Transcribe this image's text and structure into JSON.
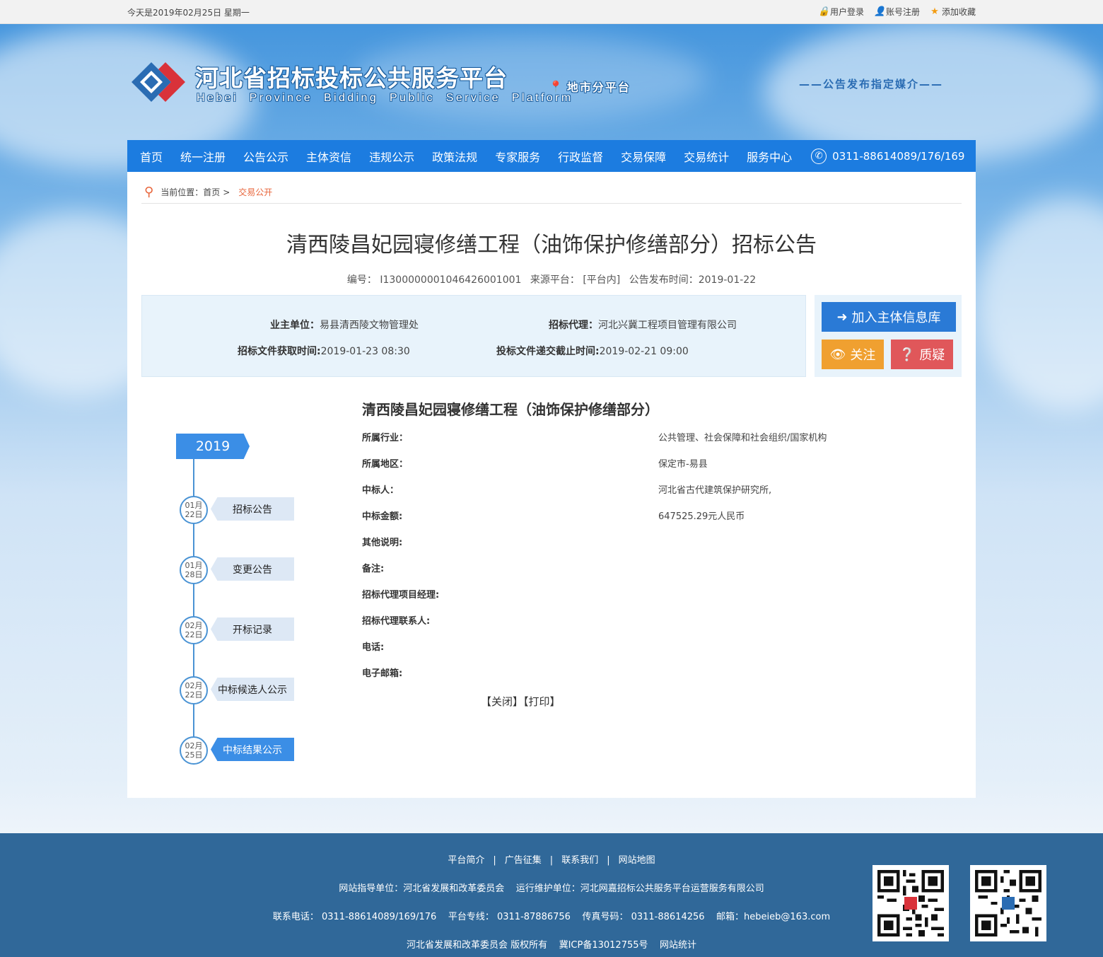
{
  "topbar": {
    "date": "今天是2019年02月25日 星期一",
    "login": "用户登录",
    "register": "账号注册",
    "favorite": "添加收藏"
  },
  "header": {
    "title": "河北省招标投标公共服务平台",
    "subtitle": "Hebei Province Bidding Public Service Platform",
    "city_platform": "地市分平台",
    "media": "——公告发布指定媒介——"
  },
  "nav": {
    "items": [
      "首页",
      "统一注册",
      "公告公示",
      "主体资信",
      "违规公示",
      "政策法规",
      "专家服务",
      "行政监督",
      "交易保障",
      "交易统计",
      "服务中心"
    ],
    "phone": "0311-88614089/176/169"
  },
  "breadcrumb": {
    "prefix": "当前位置：首页",
    "arrow": ">",
    "current": "交易公开"
  },
  "notice": {
    "title": "清西陵昌妃园寝修缮工程（油饰保护修缮部分）招标公告",
    "code_label": "编号：",
    "code": "I1300000001046426001001",
    "source_label": "来源平台：",
    "source": "[平台内]",
    "publish_label": "公告发布时间：",
    "publish": "2019-01-22"
  },
  "info": {
    "owner_label": "业主单位：",
    "owner": "易县清西陵文物管理处",
    "agent_label": "招标代理：",
    "agent": "河北兴冀工程项目管理有限公司",
    "doc_time_label": "招标文件获取时间:",
    "doc_time": "2019-01-23 08:30",
    "deadline_label": "投标文件递交截止时间:",
    "deadline": "2019-02-21 09:00"
  },
  "actions": {
    "join": "加入主体信息库",
    "follow": "关注",
    "query": "质疑"
  },
  "timeline": {
    "year": "2019",
    "items": [
      {
        "month": "01月",
        "day": "22日",
        "label": "招标公告"
      },
      {
        "month": "01月",
        "day": "28日",
        "label": "变更公告"
      },
      {
        "month": "02月",
        "day": "22日",
        "label": "开标记录"
      },
      {
        "month": "02月",
        "day": "22日",
        "label": "中标候选人公示"
      },
      {
        "month": "02月",
        "day": "25日",
        "label": "中标结果公示"
      }
    ]
  },
  "detail": {
    "heading": "清西陵昌妃园寝修缮工程（油饰保护修缮部分）",
    "rows": [
      {
        "key": "所属行业：",
        "value": "公共管理、社会保障和社会组织/国家机构"
      },
      {
        "key": "所属地区：",
        "value": "保定市-易县"
      },
      {
        "key": "中标人：",
        "value": "河北省古代建筑保护研究所,"
      },
      {
        "key": "中标金额:",
        "value": "647525.29元人民币"
      },
      {
        "key": "其他说明:",
        "value": ""
      },
      {
        "key": "备注:",
        "value": ""
      },
      {
        "key": "招标代理项目经理:",
        "value": ""
      },
      {
        "key": "招标代理联系人:",
        "value": ""
      },
      {
        "key": "电话:",
        "value": ""
      },
      {
        "key": "电子邮箱:",
        "value": ""
      }
    ],
    "close": "【关闭】",
    "print": "【打印】"
  },
  "footer": {
    "links": [
      "平台简介",
      "广告征集",
      "联系我们",
      "网站地图"
    ],
    "link_sep": "|",
    "line2": "网站指导单位：河北省发展和改革委员会    运行维护单位：河北网嘉招标公共服务平台运营服务有限公司",
    "line3": "联系电话： 0311-88614089/169/176    平台专线： 0311-87886756    传真号码： 0311-88614256    邮箱：hebeieb@163.com",
    "line4": "河北省发展和改革委员会 版权所有    冀ICP备13012755号    网站统计"
  },
  "colors": {
    "nav_bg": "#1c7ce0",
    "footer_bg": "#306899",
    "accent_orange": "#e8663c",
    "btn_follow": "#f0a030",
    "btn_query": "#e0575a"
  }
}
